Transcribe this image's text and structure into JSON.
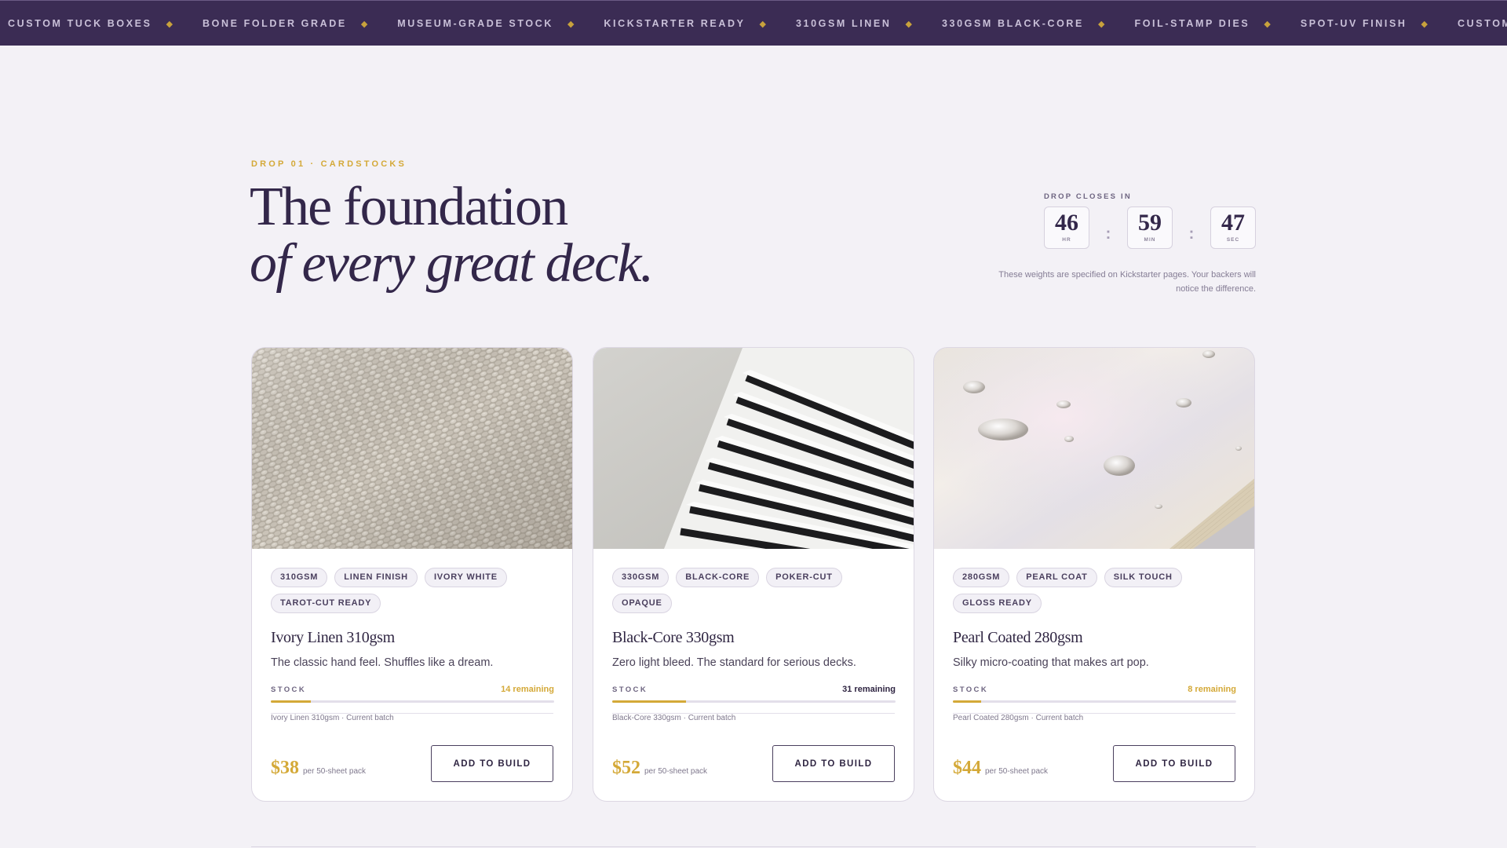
{
  "ticker": {
    "items": [
      "CUSTOM TUCK BOXES",
      "BONE FOLDER GRADE",
      "MUSEUM-GRADE STOCK",
      "KICKSTARTER READY",
      "310GSM LINEN",
      "330GSM BLACK-CORE",
      "FOIL-STAMP DIES",
      "SPOT-UV FINISH",
      "CUSTOM TUCK BOXES"
    ]
  },
  "header": {
    "eyebrow": "DROP 01 · CARDSTOCKS",
    "headline_line1": "The foundation",
    "headline_line2": "of every great deck."
  },
  "countdown": {
    "label": "DROP CLOSES IN",
    "hours": "46",
    "hours_unit": "HR",
    "minutes": "59",
    "minutes_unit": "MIN",
    "seconds": "47",
    "seconds_unit": "SEC",
    "separator": ":",
    "note": "These weights are specified on Kickstarter pages. Your backers will notice the difference."
  },
  "colors": {
    "accent": "#d4a938",
    "brand": "#3b2c54",
    "ink": "#33274a"
  },
  "products": [
    {
      "tags": [
        "310GSM",
        "LINEN FINISH",
        "IVORY WHITE",
        "TAROT-CUT READY"
      ],
      "title": "Ivory Linen 310gsm",
      "description": "The classic hand feel. Shuffles like a dream.",
      "stock_label": "STOCK",
      "remaining": "14 remaining",
      "remaining_highlight": true,
      "stock_level": 0.14,
      "batch": "Ivory Linen 310gsm · Current batch",
      "price": "$38",
      "price_unit": "per 50-sheet pack",
      "button": "ADD TO BUILD",
      "image": "linen-texture"
    },
    {
      "tags": [
        "330GSM",
        "BLACK-CORE",
        "POKER-CUT",
        "OPAQUE"
      ],
      "title": "Black-Core 330gsm",
      "description": "Zero light bleed. The standard for serious decks.",
      "stock_label": "STOCK",
      "remaining": "31 remaining",
      "remaining_highlight": false,
      "stock_level": 0.26,
      "batch": "Black-Core 330gsm · Current batch",
      "price": "$52",
      "price_unit": "per 50-sheet pack",
      "button": "ADD TO BUILD",
      "image": "black-core-fan"
    },
    {
      "tags": [
        "280GSM",
        "PEARL COAT",
        "SILK TOUCH",
        "GLOSS READY"
      ],
      "title": "Pearl Coated 280gsm",
      "description": "Silky micro-coating that makes art pop.",
      "stock_label": "STOCK",
      "remaining": "8 remaining",
      "remaining_highlight": true,
      "stock_level": 0.1,
      "batch": "Pearl Coated 280gsm · Current batch",
      "price": "$44",
      "price_unit": "per 50-sheet pack",
      "button": "ADD TO BUILD",
      "image": "pearl-droplets"
    }
  ]
}
